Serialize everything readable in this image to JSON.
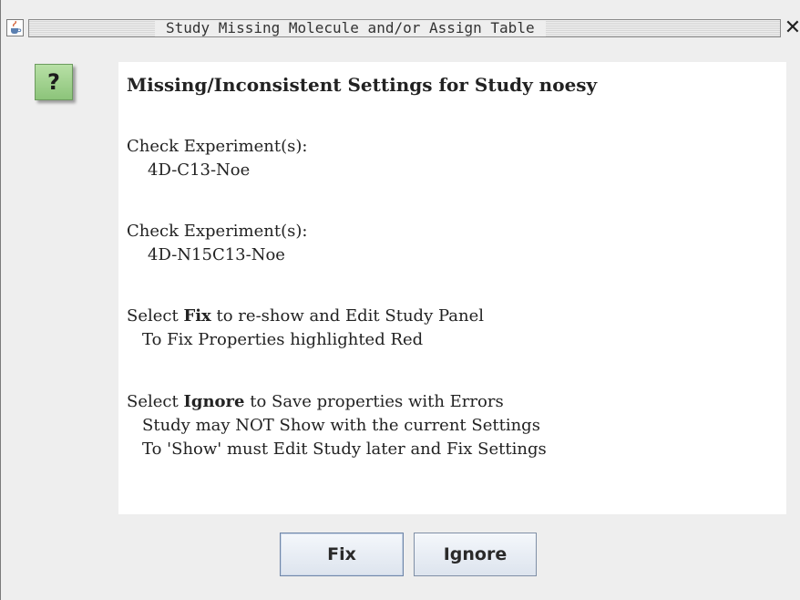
{
  "window": {
    "title": "Study Missing Molecule and/or Assign Table"
  },
  "icons": {
    "app": "java-icon",
    "close": "close-icon",
    "dialog": "question-icon",
    "dialog_glyph": "?"
  },
  "message": {
    "heading": "Missing/Inconsistent Settings for Study noesy",
    "check1_label": "Check Experiment(s):",
    "check1_value": "4D-C13-Noe",
    "check2_label": "Check Experiment(s):",
    "check2_value": "4D-N15C13-Noe",
    "fix_prefix": "Select ",
    "fix_bold": "Fix",
    "fix_suffix": " to re-show and Edit Study Panel",
    "fix_detail": "To Fix Properties highlighted Red",
    "ignore_prefix": "Select ",
    "ignore_bold": "Ignore",
    "ignore_suffix": " to Save properties with Errors",
    "ignore_detail1": "Study may NOT Show with the current Settings",
    "ignore_detail2": "To 'Show' must Edit Study later and Fix Settings"
  },
  "buttons": {
    "fix": "Fix",
    "ignore": "Ignore"
  },
  "colors": {
    "dialog_background": "#eeeeee",
    "message_background": "#ffffff",
    "question_icon_fill": "#a6d492",
    "button_fill": "#e6ebf2"
  }
}
